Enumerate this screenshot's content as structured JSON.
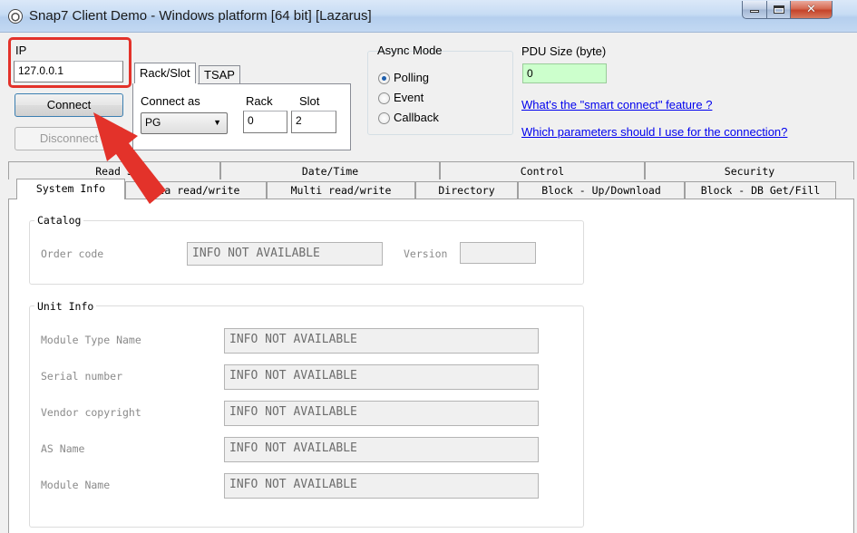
{
  "window": {
    "title": "Snap7 Client Demo - Windows platform [64 bit] [Lazarus]"
  },
  "connection": {
    "ip_label": "IP",
    "ip_value": "127.0.0.1",
    "connect_label": "Connect",
    "disconnect_label": "Disconnect",
    "tabs": [
      "Rack/Slot",
      "TSAP"
    ],
    "connect_as_label": "Connect as",
    "connect_as_value": "PG",
    "rack_label": "Rack",
    "rack_value": "0",
    "slot_label": "Slot",
    "slot_value": "2"
  },
  "async": {
    "label": "Async Mode",
    "options": [
      "Polling",
      "Event",
      "Callback"
    ],
    "selected": "Polling"
  },
  "pdu": {
    "label": "PDU Size (byte)",
    "value": "0"
  },
  "links": {
    "smart_connect": "What's the \"smart connect\" feature ?",
    "parameters": "Which parameters should I use for the connection?"
  },
  "tabs_row1": [
    "Read S",
    "Date/Time",
    "Control",
    "Security"
  ],
  "tabs_row2": [
    "System Info",
    "ata read/write",
    "Multi read/write",
    "Directory",
    "Block - Up/Download",
    "Block - DB Get/Fill"
  ],
  "catalog": {
    "title": "Catalog",
    "order_code_label": "Order code",
    "order_code_value": "INFO NOT AVAILABLE",
    "version_label": "Version",
    "version_value": ""
  },
  "unit_info": {
    "title": "Unit Info",
    "fields": [
      {
        "label": "Module Type Name",
        "value": "INFO NOT AVAILABLE"
      },
      {
        "label": "Serial number",
        "value": "INFO NOT AVAILABLE"
      },
      {
        "label": "Vendor copyright",
        "value": "INFO NOT AVAILABLE"
      },
      {
        "label": "AS Name",
        "value": "INFO NOT AVAILABLE"
      },
      {
        "label": "Module Name",
        "value": "INFO NOT AVAILABLE"
      }
    ]
  },
  "colors": {
    "highlight": "#e3322a",
    "pdu_background": "#ccffcc",
    "link": "#0000ee"
  }
}
